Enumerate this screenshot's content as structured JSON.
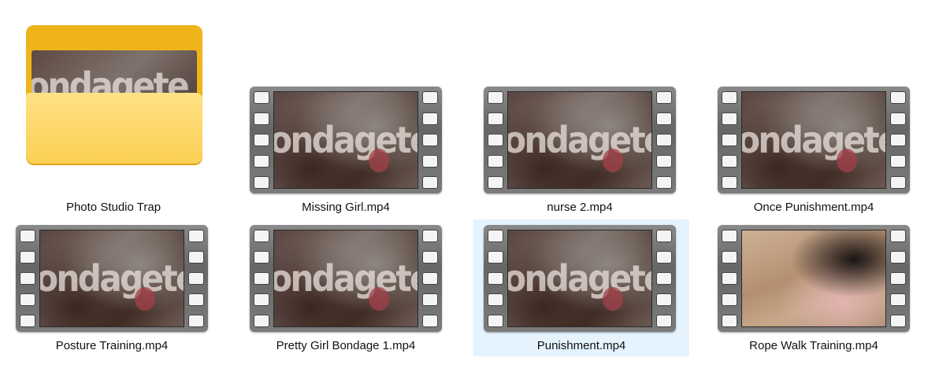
{
  "watermark": "ondagete",
  "items": [
    {
      "type": "folder",
      "name": "Photo Studio Trap",
      "icon": "folder-icon",
      "selected": false
    },
    {
      "type": "video",
      "name": "Missing Girl.mp4",
      "icon": "video-thumbnail",
      "selected": false
    },
    {
      "type": "video",
      "name": "nurse 2.mp4",
      "icon": "video-thumbnail",
      "selected": false
    },
    {
      "type": "video",
      "name": "Once Punishment.mp4",
      "icon": "video-thumbnail",
      "selected": false
    },
    {
      "type": "video",
      "name": "Posture Training.mp4",
      "icon": "video-thumbnail",
      "selected": false
    },
    {
      "type": "video",
      "name": "Pretty Girl Bondage 1.mp4",
      "icon": "video-thumbnail",
      "selected": false
    },
    {
      "type": "video",
      "name": "Punishment.mp4",
      "icon": "video-thumbnail",
      "selected": true
    },
    {
      "type": "video",
      "name": "Rope Walk Training.mp4",
      "icon": "video-thumbnail",
      "selected": false
    }
  ],
  "colors": {
    "selection": "#e5f3ff",
    "folder": "#efb41a",
    "folder_front": "#ffe184"
  }
}
